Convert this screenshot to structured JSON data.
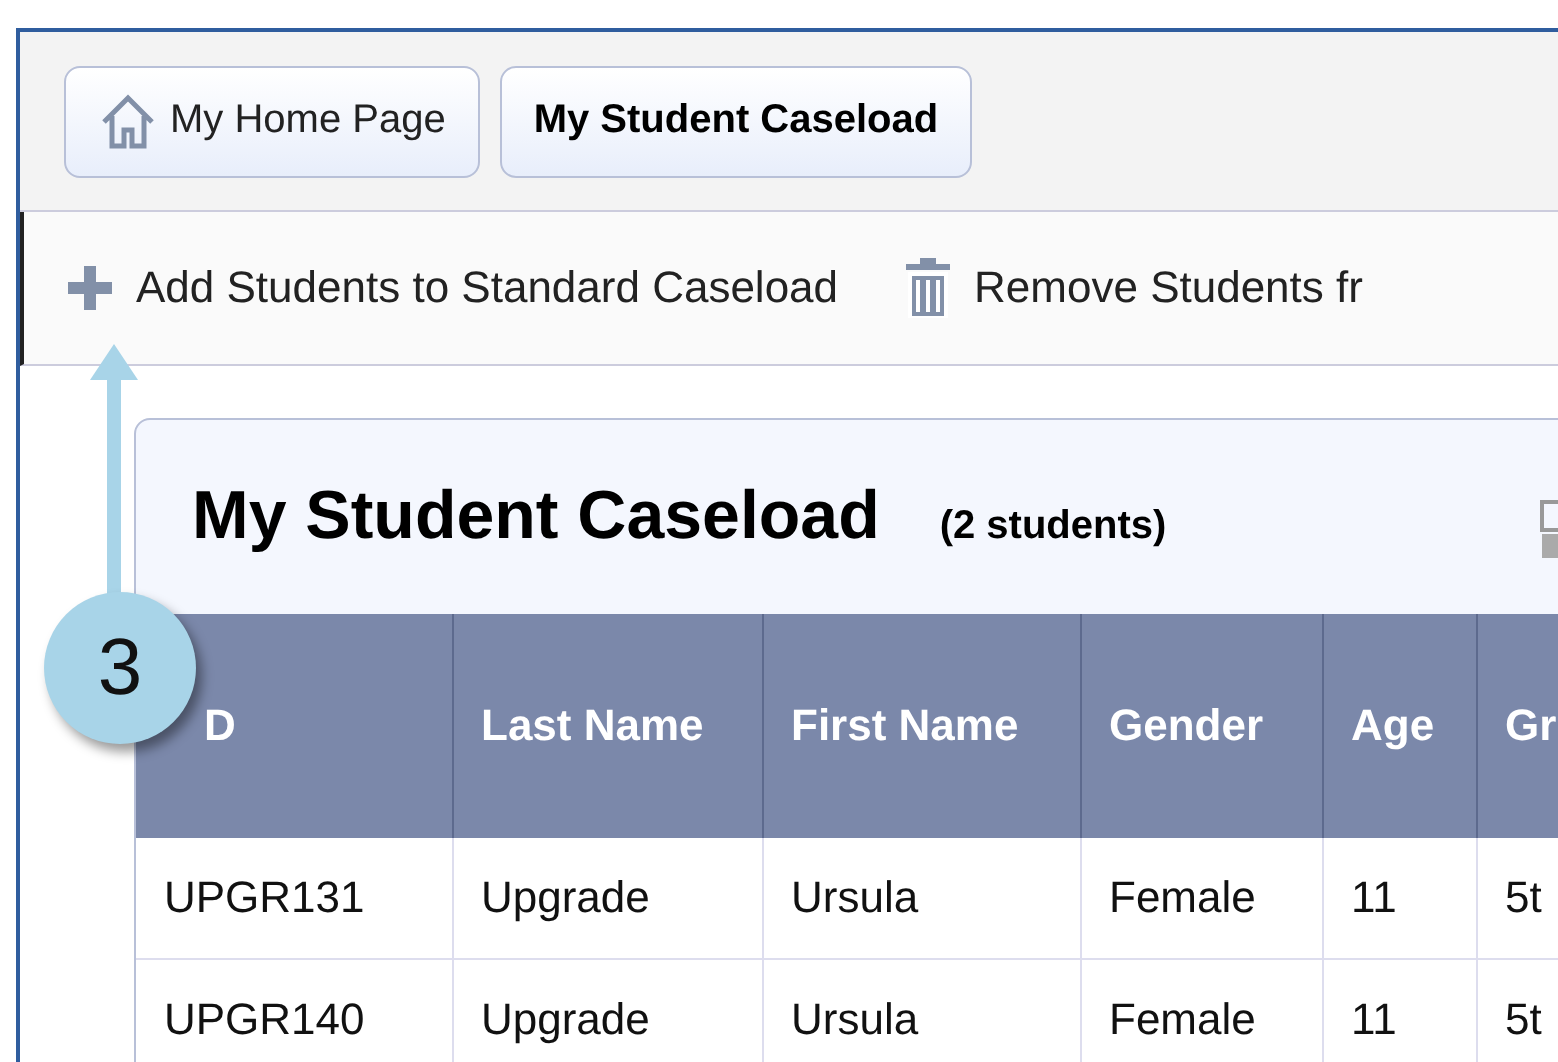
{
  "breadcrumbs": [
    {
      "label": "My Home Page",
      "kind": "home",
      "selected": false
    },
    {
      "label": "My Student Caseload",
      "kind": "page",
      "selected": true
    }
  ],
  "toolbar": [
    {
      "label": "Add Students to Standard Caseload",
      "kind": "add"
    },
    {
      "label": "Remove Students fr",
      "kind": "remove"
    }
  ],
  "card": {
    "title": "My Student Caseload",
    "count": "(2 students)"
  },
  "table": {
    "columns": [
      "D",
      "Last Name",
      "First Name",
      "Gender",
      "Age",
      "Gr"
    ],
    "rows": [
      [
        "UPGR131",
        "Upgrade",
        "Ursula",
        "Female",
        "11",
        "5t"
      ],
      [
        "UPGR140",
        "Upgrade",
        "Ursula",
        "Female",
        "11",
        "5t"
      ]
    ]
  },
  "callout": {
    "number": "3"
  }
}
